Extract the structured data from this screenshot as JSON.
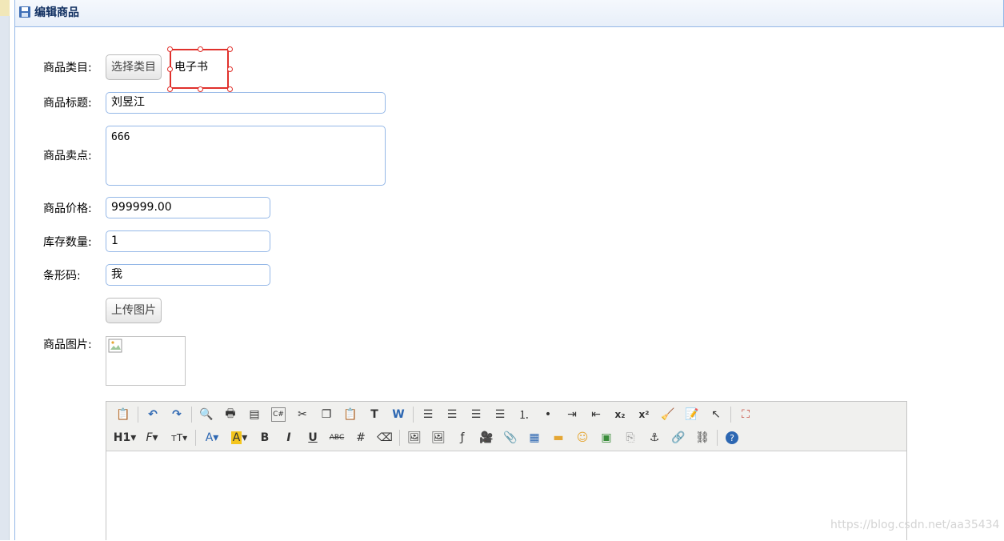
{
  "panel": {
    "title": "编辑商品"
  },
  "form": {
    "category": {
      "label": "商品类目:",
      "button": "选择类目",
      "value": "电子书"
    },
    "title": {
      "label": "商品标题:",
      "value": "刘昱江"
    },
    "sell_point": {
      "label": "商品卖点:",
      "value": "666"
    },
    "price": {
      "label": "商品价格:",
      "value": "999999.00"
    },
    "stock": {
      "label": "库存数量:",
      "value": "1"
    },
    "barcode": {
      "label": "条形码:",
      "value": "我"
    },
    "upload": {
      "button": "上传图片"
    },
    "image": {
      "label": "商品图片:"
    }
  },
  "editor": {
    "row1": [
      "source-icon",
      "undo-icon",
      "redo-icon",
      "preview-icon",
      "print-icon",
      "template-icon",
      "code-icon",
      "cut-icon",
      "copy-icon",
      "paste-icon",
      "paste-text-icon",
      "paste-word-icon",
      "align-left-icon",
      "align-center-icon",
      "align-right-icon",
      "justify-icon",
      "ordered-list-icon",
      "unordered-list-icon",
      "indent-icon",
      "outdent-icon",
      "subscript-icon",
      "superscript-icon",
      "clear-format-icon",
      "select-all-icon",
      "pointer-icon",
      "fullscreen-icon"
    ],
    "row2": [
      "heading-icon",
      "font-family-icon",
      "font-size-icon",
      "font-color-icon",
      "highlight-icon",
      "bold-icon",
      "italic-icon",
      "underline-icon",
      "strikethrough-icon",
      "line-height-icon",
      "eraser-icon",
      "image-icon",
      "multi-image-icon",
      "flash-icon",
      "media-icon",
      "attachment-icon",
      "table-icon",
      "hr-icon",
      "emoticon-icon",
      "map-icon",
      "pagebreak-icon",
      "anchor-icon",
      "link-icon",
      "unlink-icon",
      "about-icon"
    ]
  },
  "watermark": "https://blog.csdn.net/aa35434",
  "colors": {
    "border": "#95b8e7",
    "header_text": "#0e2d5f",
    "selection": "#e0312c"
  }
}
